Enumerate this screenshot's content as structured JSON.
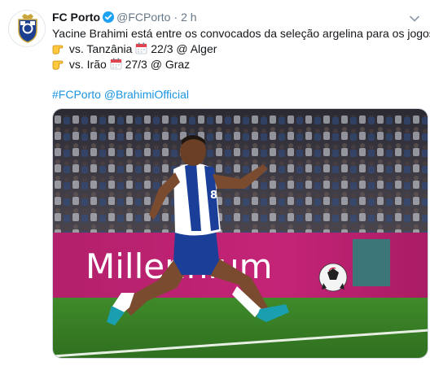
{
  "tweet": {
    "author_name": "FC Porto",
    "handle": "@FCPorto",
    "separator": "·",
    "time": "2 h",
    "line1": "Yacine Brahimi está entre os convocados da seleção argelina para os jogos:",
    "match1_text": "vs. Tanzânia",
    "match1_date": "22/3 @ Alger",
    "match2_text": "vs. Irão",
    "match2_date": "27/3 @ Graz",
    "hashtag": "#FCPorto",
    "mention": "@BrahimiOfficial"
  },
  "media": {
    "banner_text": "Millennium",
    "player_number": "8"
  },
  "icons": {
    "avatar": "fc-porto-crest-icon",
    "verified": "verified-badge-icon",
    "caret": "chevron-down-icon",
    "pointing": "backhand-index-pointing-right-icon",
    "calendar": "calendar-icon"
  },
  "colors": {
    "link": "#1b95e0",
    "verified": "#1da1f2",
    "porto_blue": "#1d3f8f"
  }
}
